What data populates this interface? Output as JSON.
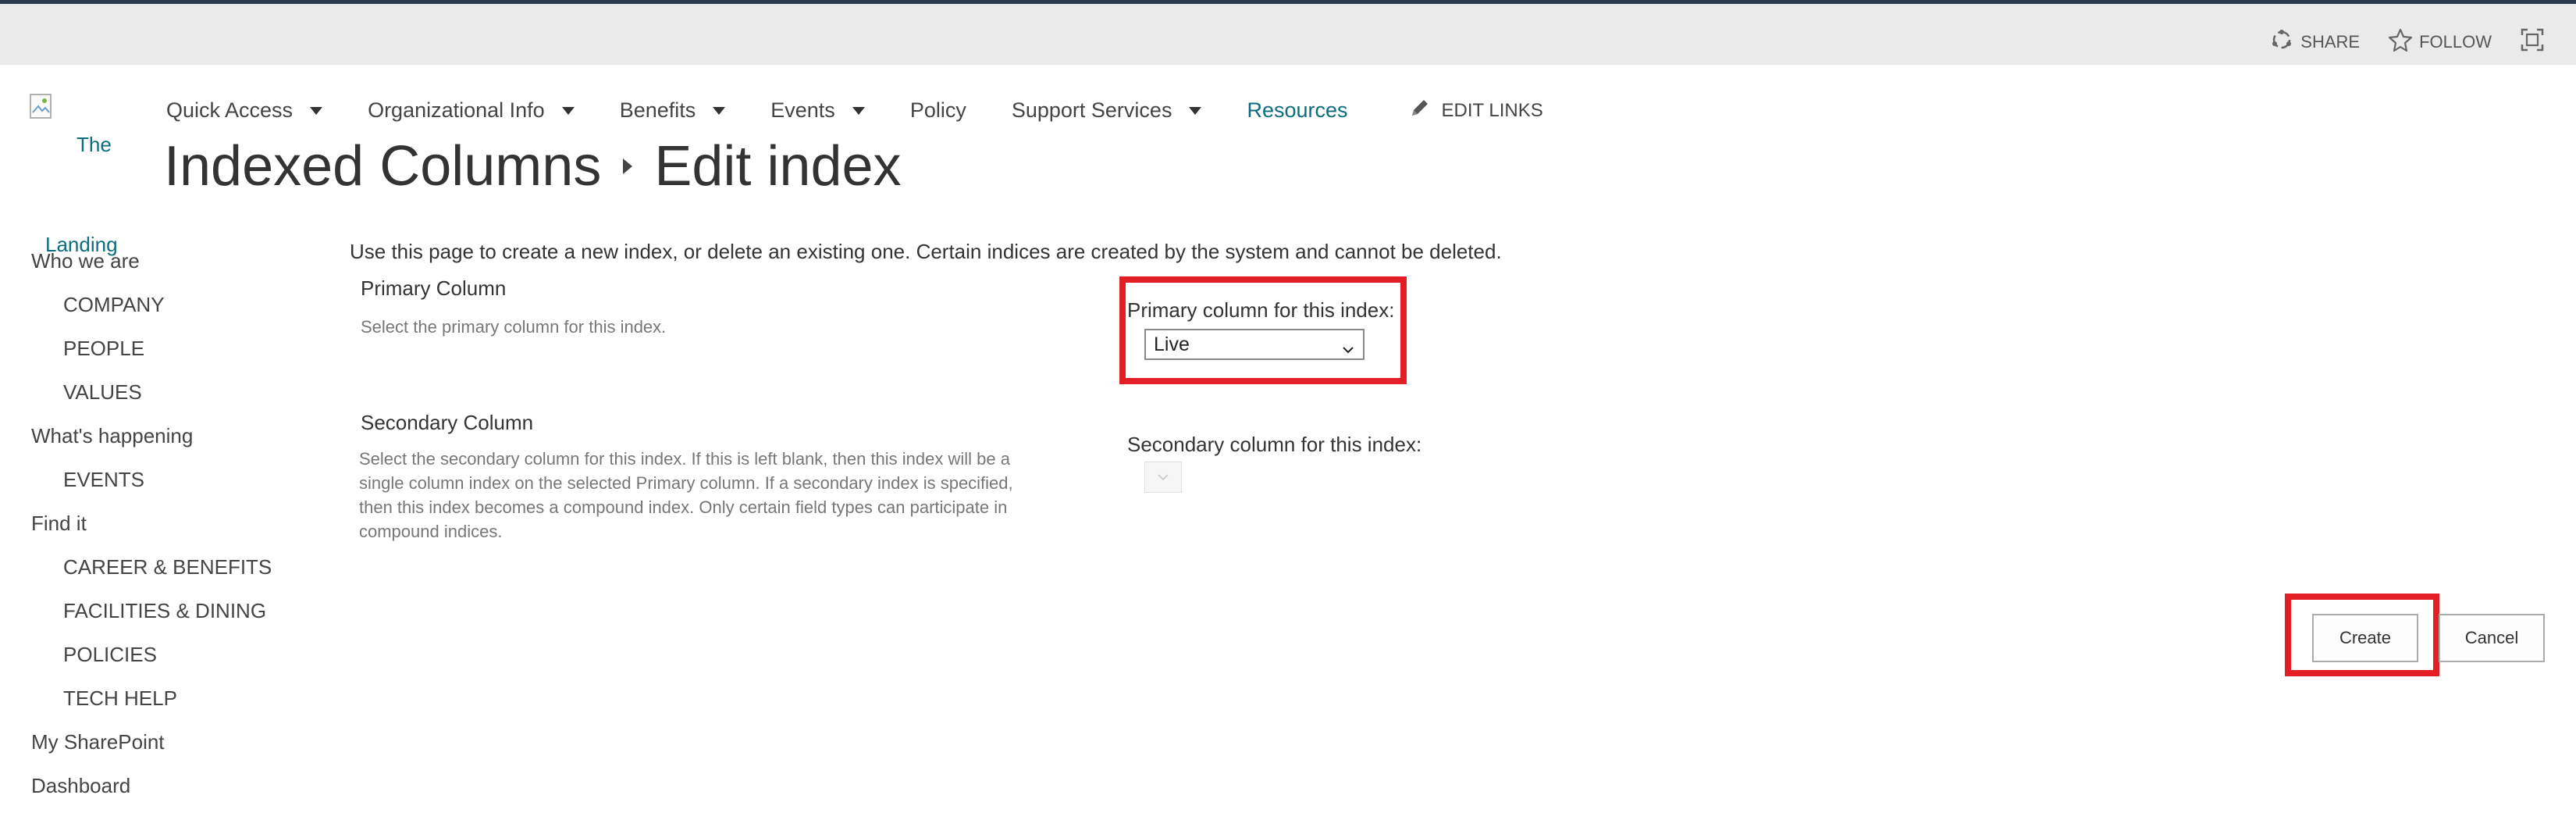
{
  "suite": {
    "share_label": "SHARE",
    "follow_label": "FOLLOW"
  },
  "logo": {
    "alt_line1": "The",
    "alt_line2": "Landing"
  },
  "topnav": {
    "items": [
      {
        "label": "Quick Access"
      },
      {
        "label": "Organizational Info"
      },
      {
        "label": "Benefits"
      },
      {
        "label": "Events"
      },
      {
        "label": "Policy"
      },
      {
        "label": "Support Services"
      },
      {
        "label": "Resources"
      }
    ],
    "edit_links_label": "EDIT LINKS"
  },
  "page": {
    "breadcrumb_parent": "Indexed Columns",
    "title": "Edit index"
  },
  "leftnav": {
    "items": [
      {
        "label": "Who we are"
      },
      {
        "label": "COMPANY"
      },
      {
        "label": "PEOPLE"
      },
      {
        "label": "VALUES"
      },
      {
        "label": "What's happening"
      },
      {
        "label": "EVENTS"
      },
      {
        "label": "Find it"
      },
      {
        "label": "CAREER & BENEFITS"
      },
      {
        "label": "FACILITIES & DINING"
      },
      {
        "label": "POLICIES"
      },
      {
        "label": "TECH HELP"
      },
      {
        "label": "My SharePoint"
      },
      {
        "label": "Dashboard"
      }
    ]
  },
  "form": {
    "intro": "Use this page to create a new index, or delete an existing one. Certain indices are created by the system and cannot be deleted.",
    "primary": {
      "section_title": "Primary Column",
      "description": "Select the primary column for this index.",
      "field_label": "Primary column for this index:",
      "value": "Live"
    },
    "secondary": {
      "section_title": "Secondary Column",
      "description_lines": [
        "Select the secondary column for this index. If this is left blank, then this index will be a",
        "single column index on the selected Primary column. If a secondary index is specified,",
        "then this index becomes a compound index. Only certain field types can participate in",
        "compound indices."
      ],
      "field_label": "Secondary column for this index:",
      "value": ""
    },
    "create_label": "Create",
    "cancel_label": "Cancel"
  },
  "colors": {
    "accent": "#0c6d7f",
    "highlight": "#e31e24",
    "suitebar": "#eaeaea",
    "topstrip": "#2b3a4e"
  },
  "icons": [
    "share-icon",
    "follow-star-icon",
    "focus-icon",
    "pencil-icon",
    "chevron-down-icon"
  ]
}
